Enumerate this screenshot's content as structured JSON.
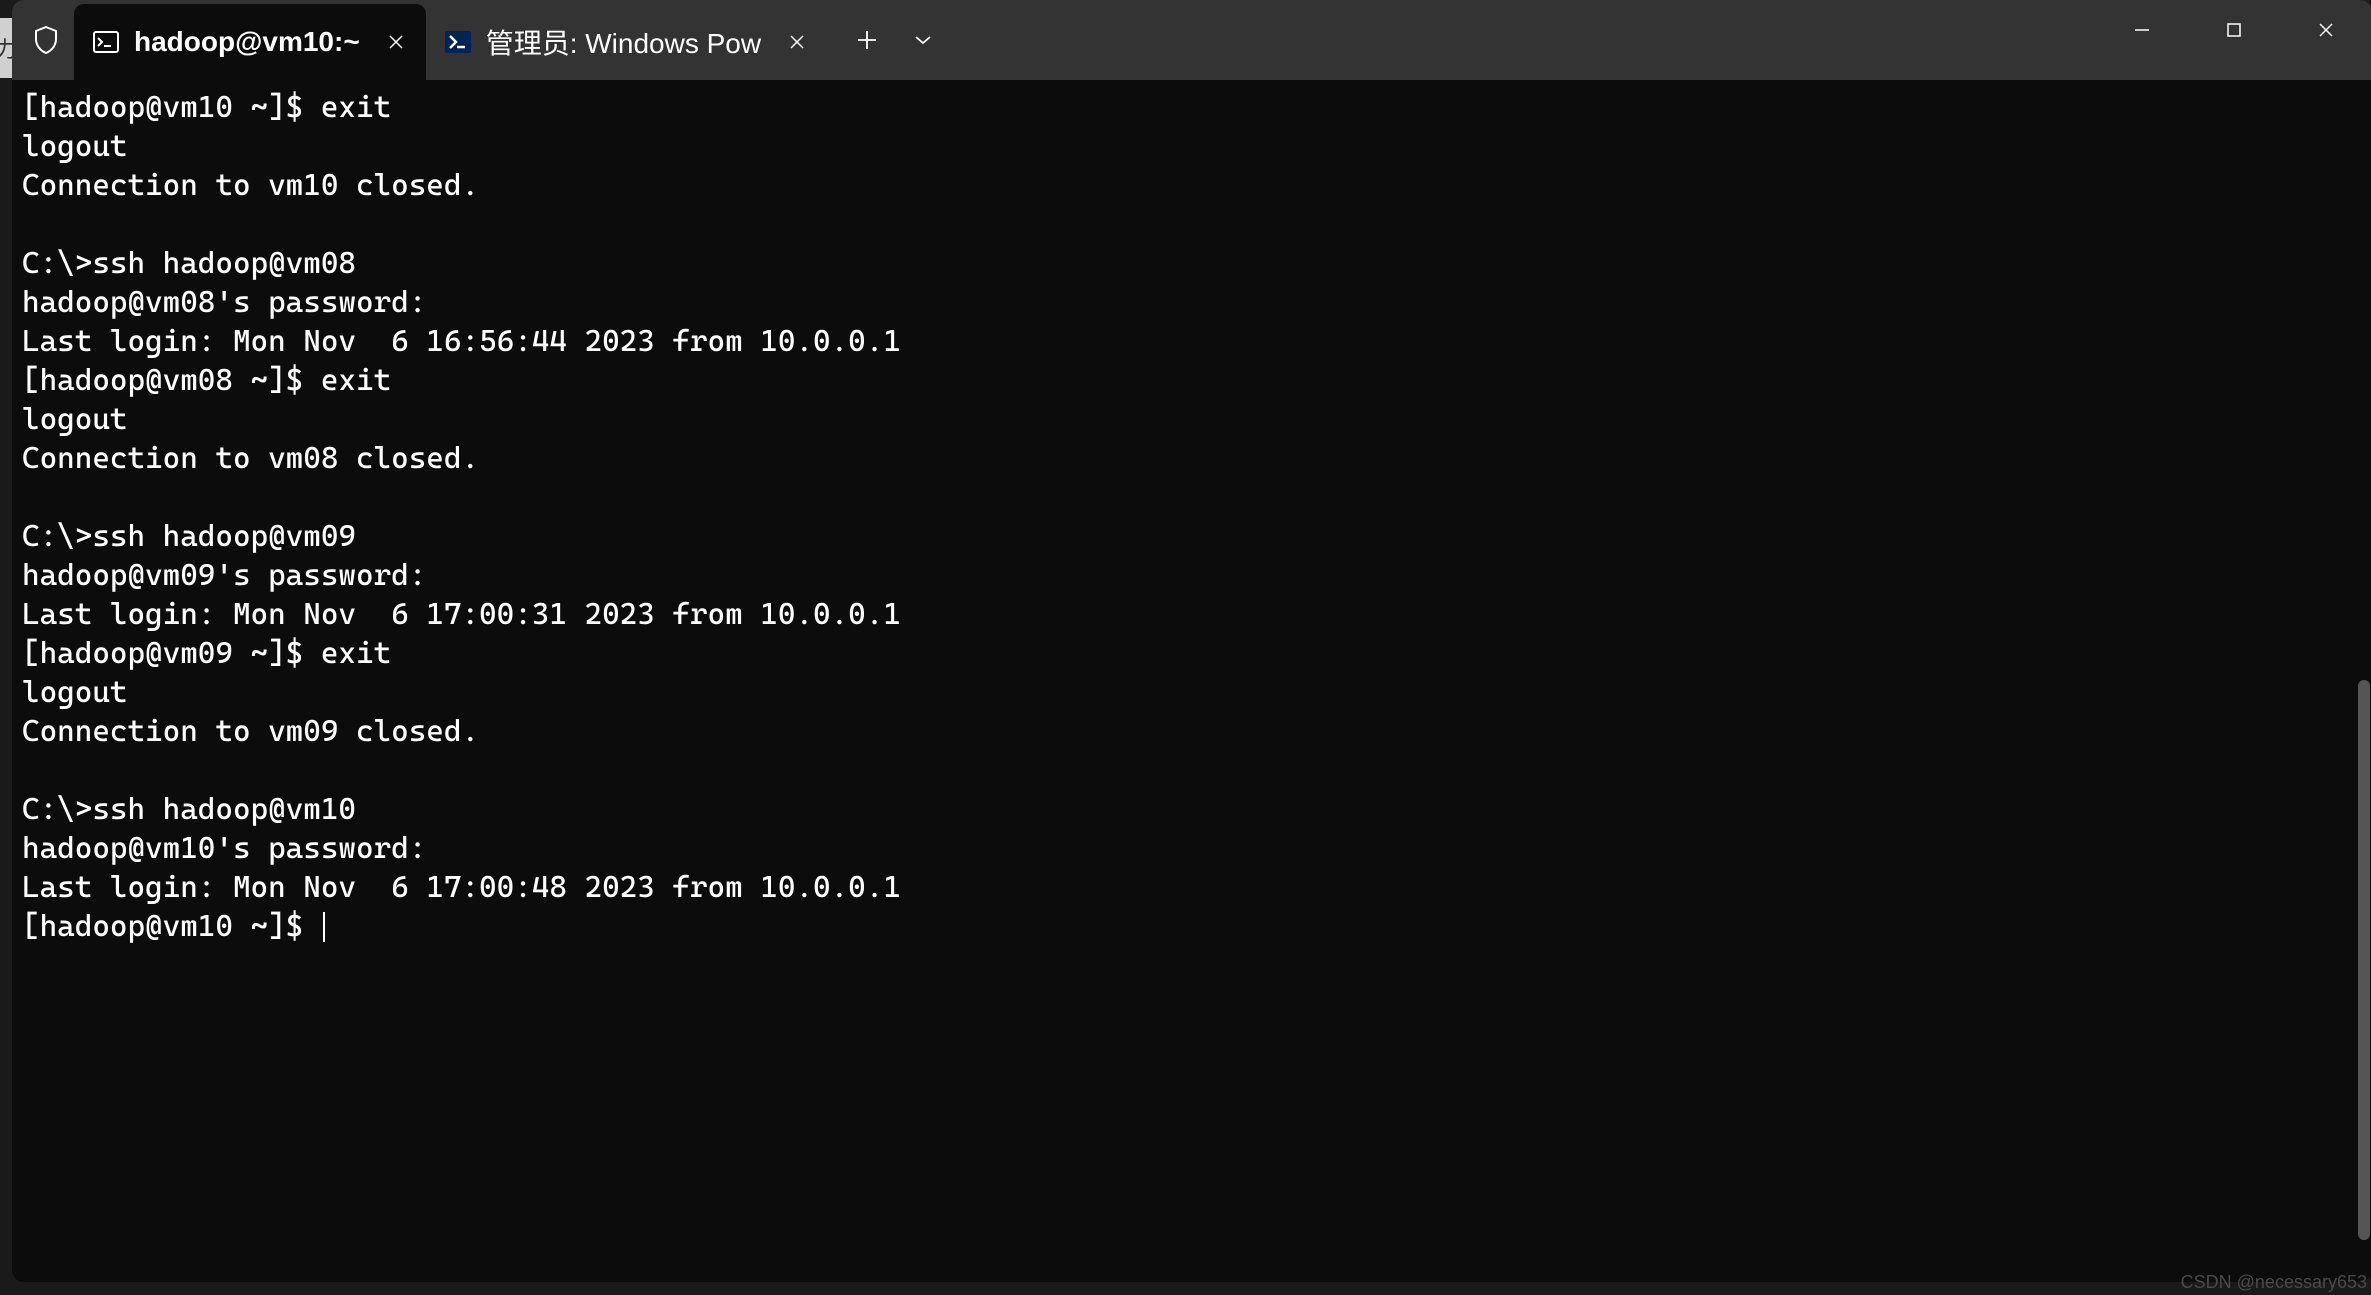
{
  "tabs": [
    {
      "title": "hadoop@vm10:~",
      "icon": "terminal-icon",
      "active": true
    },
    {
      "title": "管理员: Windows Pow",
      "icon": "powershell-icon",
      "active": false
    }
  ],
  "terminal": {
    "lines": [
      "[hadoop@vm10 ~]$ exit",
      "logout",
      "Connection to vm10 closed.",
      "",
      "C:\\>ssh hadoop@vm08",
      "hadoop@vm08's password:",
      "Last login: Mon Nov  6 16:56:44 2023 from 10.0.0.1",
      "[hadoop@vm08 ~]$ exit",
      "logout",
      "Connection to vm08 closed.",
      "",
      "C:\\>ssh hadoop@vm09",
      "hadoop@vm09's password:",
      "Last login: Mon Nov  6 17:00:31 2023 from 10.0.0.1",
      "[hadoop@vm09 ~]$ exit",
      "logout",
      "Connection to vm09 closed.",
      "",
      "C:\\>ssh hadoop@vm10",
      "hadoop@vm10's password:",
      "Last login: Mon Nov  6 17:00:48 2023 from 10.0.0.1",
      "[hadoop@vm10 ~]$ "
    ]
  },
  "watermark": "CSDN @necessary653"
}
